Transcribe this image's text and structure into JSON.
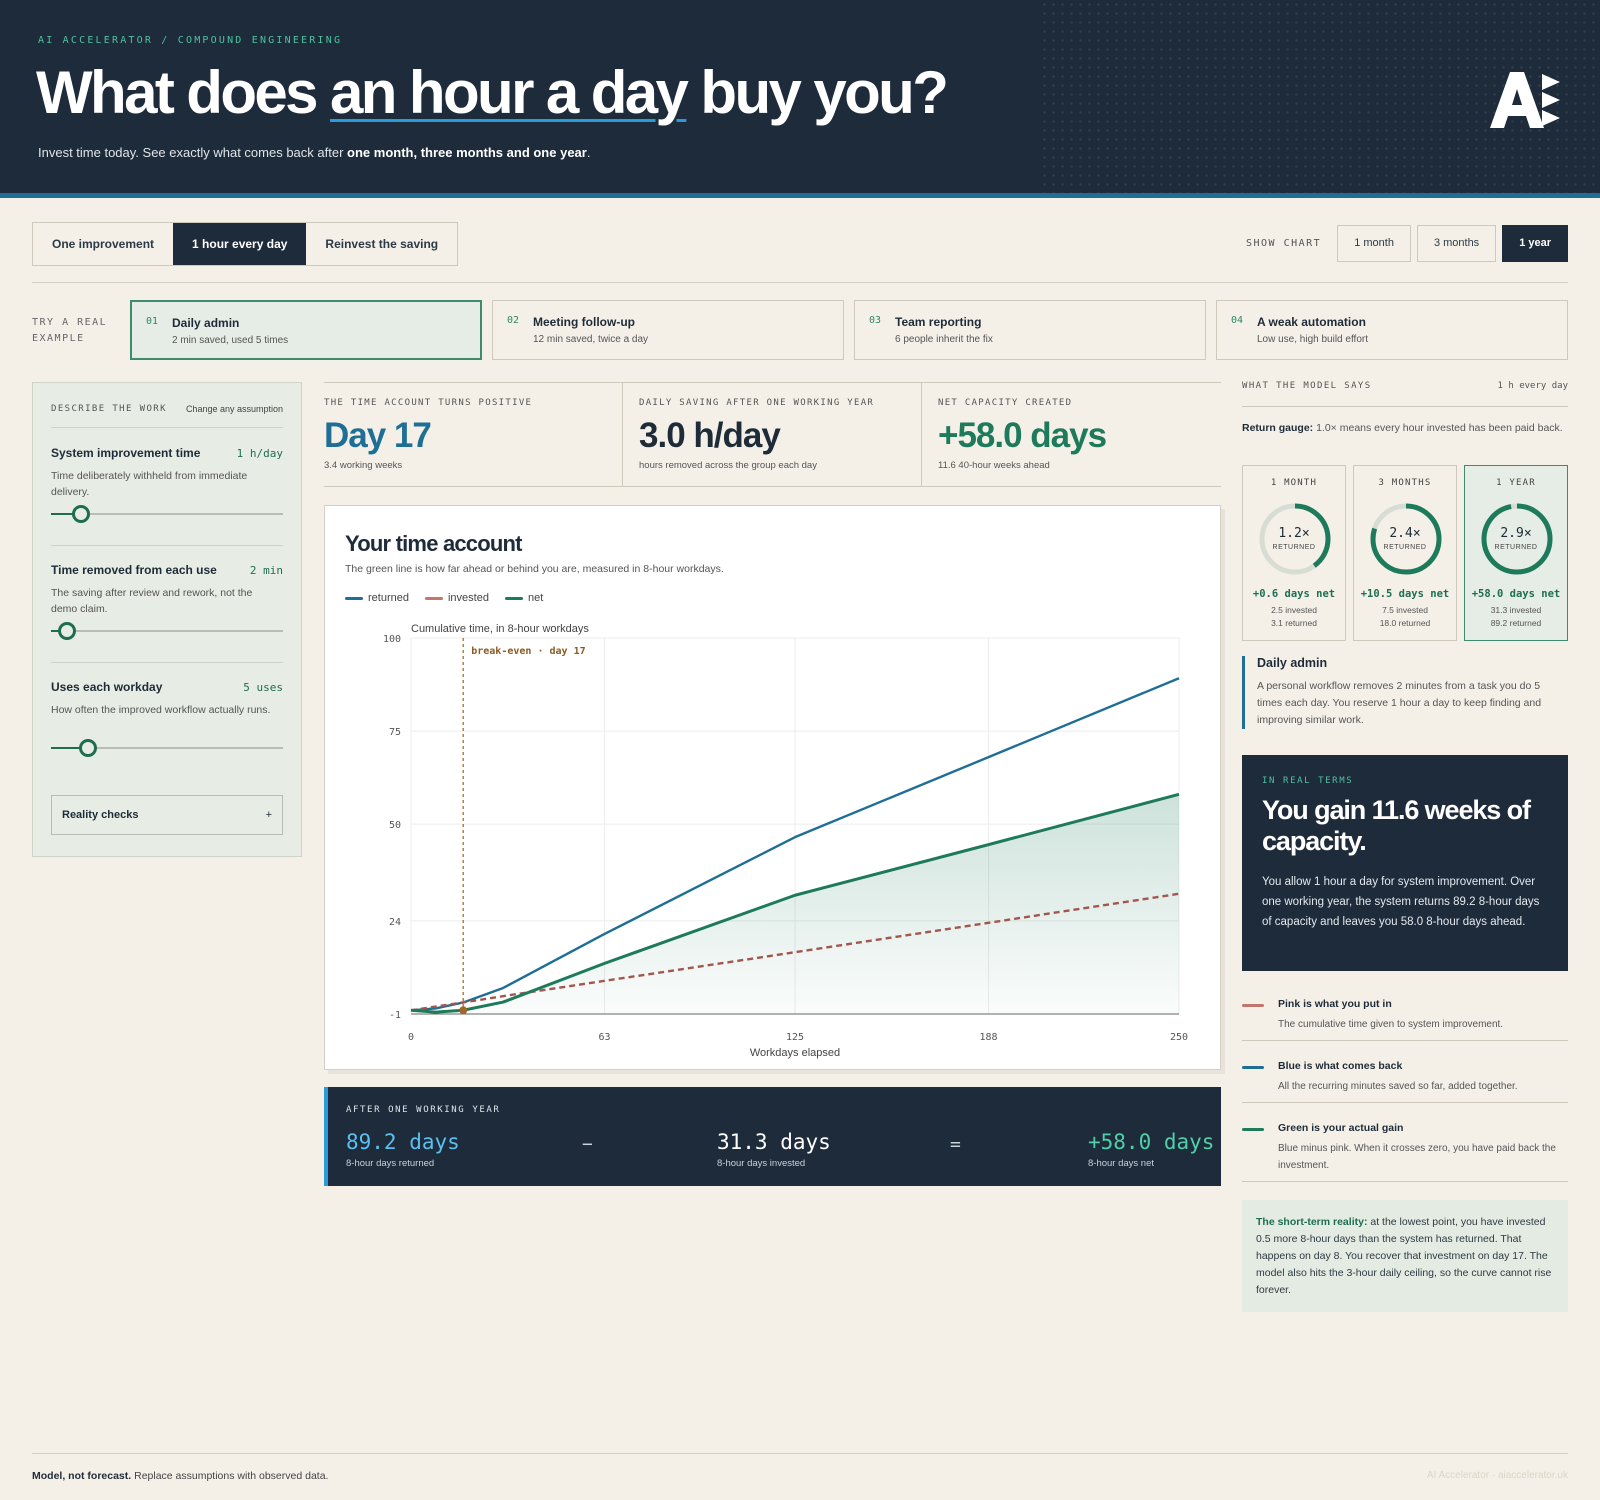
{
  "header": {
    "kicker": "AI ACCELERATOR / COMPOUND ENGINEERING",
    "title_a": "What does",
    "title_b": "an hour a day",
    "title_c": "buy you?",
    "sub_a": "Invest time today. See exactly what comes back after",
    "sub_b": "one month, three months and one year",
    "sub_c": "."
  },
  "modes": [
    "One improvement",
    "1 hour every day",
    "Reinvest the saving"
  ],
  "mode_selected": 1,
  "range": {
    "label": "SHOW CHART",
    "options": [
      "1 month",
      "3 months",
      "1 year"
    ],
    "selected": 2
  },
  "examples": {
    "label": "TRY A REAL EXAMPLE",
    "items": [
      {
        "n": "01",
        "t": "Daily admin",
        "d": "2 min saved, used 5 times"
      },
      {
        "n": "02",
        "t": "Meeting follow-up",
        "d": "12 min saved, twice a day"
      },
      {
        "n": "03",
        "t": "Team reporting",
        "d": "6 people inherit the fix"
      },
      {
        "n": "04",
        "t": "A weak automation",
        "d": "Low use, high build effort"
      }
    ]
  },
  "panel": {
    "title": "DESCRIBE THE WORK",
    "hint": "Change any assumption",
    "fields": [
      {
        "name": "System improvement time",
        "value": "1 h/day",
        "desc": "Time deliberately withheld from immediate delivery.",
        "level": 0.13
      },
      {
        "name": "Time removed from each use",
        "value": "2 min",
        "desc": "The saving after review and rework, not the demo claim.",
        "level": 0.07
      },
      {
        "name": "Uses each workday",
        "value": "5 uses",
        "desc": "How often the improved workflow actually runs.",
        "level": 0.16
      }
    ],
    "reality_checks": "Reality checks",
    "plus": "+"
  },
  "stats": [
    {
      "k": "THE TIME ACCOUNT TURNS POSITIVE",
      "v": "Day 17",
      "s": "3.4 working weeks",
      "color": "#1f6e96"
    },
    {
      "k": "DAILY SAVING AFTER ONE WORKING YEAR",
      "v": "3.0 h/day",
      "s": "hours removed across the group each day",
      "color": "#1e2b38"
    },
    {
      "k": "NET CAPACITY CREATED",
      "v": "+58.0 days",
      "s": "11.6 40-hour weeks ahead",
      "color": "#1d7a5a"
    }
  ],
  "card": {
    "title": "Your time account",
    "sub": "The green line is how far ahead or behind you are, measured in 8-hour workdays.",
    "legend": [
      "returned",
      "invested",
      "net"
    ]
  },
  "chart_data": {
    "type": "line",
    "title": "Cumulative time, in 8-hour workdays",
    "xlabel": "Workdays elapsed",
    "ylabel": "",
    "x_ticks": [
      "0",
      "63",
      "125",
      "188",
      "250"
    ],
    "y_ticks": [
      "-1",
      "24",
      "50",
      "75",
      "100"
    ],
    "xlim": [
      0,
      250
    ],
    "ylim": [
      -1,
      100
    ],
    "grid": true,
    "annotation": "break-even · day 17",
    "break_even_x": 17,
    "x": [
      0,
      8,
      17,
      30,
      63,
      125,
      188,
      250
    ],
    "series": [
      {
        "name": "returned",
        "color": "#1f6e96",
        "values": [
          0,
          0.5,
          2.1,
          6.0,
          20.5,
          46.5,
          68.0,
          89.2
        ]
      },
      {
        "name": "invested",
        "color": "#a3564e",
        "dash": true,
        "values": [
          0,
          1.0,
          2.1,
          3.8,
          7.9,
          15.6,
          23.5,
          31.3
        ]
      },
      {
        "name": "net",
        "color": "#1d7a5a",
        "values": [
          0,
          -0.5,
          0,
          2.2,
          12.6,
          30.9,
          44.5,
          58.0
        ]
      }
    ]
  },
  "summary": {
    "k": "AFTER ONE WORKING YEAR",
    "returned": "89.2 days",
    "returned_s": "8-hour days returned",
    "minus": "−",
    "invested": "31.3 days",
    "invested_s": "8-hour days invested",
    "equals": "=",
    "net": "+58.0 days",
    "net_s": "8-hour days net"
  },
  "right": {
    "title": "WHAT THE MODEL SAYS",
    "tag": "1 h every day",
    "gauge_b": "Return gauge:",
    "gauge_note": " 1.0× means every hour invested has been paid back.",
    "gauges": [
      {
        "k": "1 MONTH",
        "v": "1.2×",
        "r": "RETURNED",
        "net": "+0.6 days net",
        "inv": "2.5 invested",
        "ret": "3.1 returned",
        "level": 0.4
      },
      {
        "k": "3 MONTHS",
        "v": "2.4×",
        "r": "RETURNED",
        "net": "+10.5 days net",
        "inv": "7.5 invested",
        "ret": "18.0 returned",
        "level": 0.8
      },
      {
        "k": "1 YEAR",
        "v": "2.9×",
        "r": "RETURNED",
        "net": "+58.0 days net",
        "inv": "31.3 invested",
        "ret": "89.2 returned",
        "level": 0.97
      }
    ],
    "example_t": "Daily admin",
    "example_d": "A personal workflow removes 2 minutes from a task you do 5 times each day. You reserve 1 hour a day to keep finding and improving similar work.",
    "real_k": "IN REAL TERMS",
    "real_h": "You gain 11.6 weeks of capacity.",
    "real_d": "You allow 1 hour a day for system improvement. Over one working year, the system returns 89.2 8-hour days of capacity and leaves you 58.0 8-hour days ahead.",
    "keys": [
      {
        "t": "Pink is what you put in",
        "d": "The cumulative time given to system improvement.",
        "color": "#c2766c"
      },
      {
        "t": "Blue is what comes back",
        "d": "All the recurring minutes saved so far, added together.",
        "color": "#1f6e96"
      },
      {
        "t": "Green is your actual gain",
        "d": "Blue minus pink. When it crosses zero, you have paid back the investment.",
        "color": "#1d7a5a"
      }
    ],
    "reality_b": "The short-term reality:",
    "reality_d": " at the lowest point, you have invested 0.5 more 8-hour days than the system has returned. That happens on day 8. You recover that investment on day 17. The model also hits the 3-hour daily ceiling, so the curve cannot rise forever."
  },
  "footer": {
    "b": "Model, not forecast.",
    "t": " Replace assumptions with observed data.",
    "r": "AI Accelerator · aiaccelerator.uk"
  }
}
